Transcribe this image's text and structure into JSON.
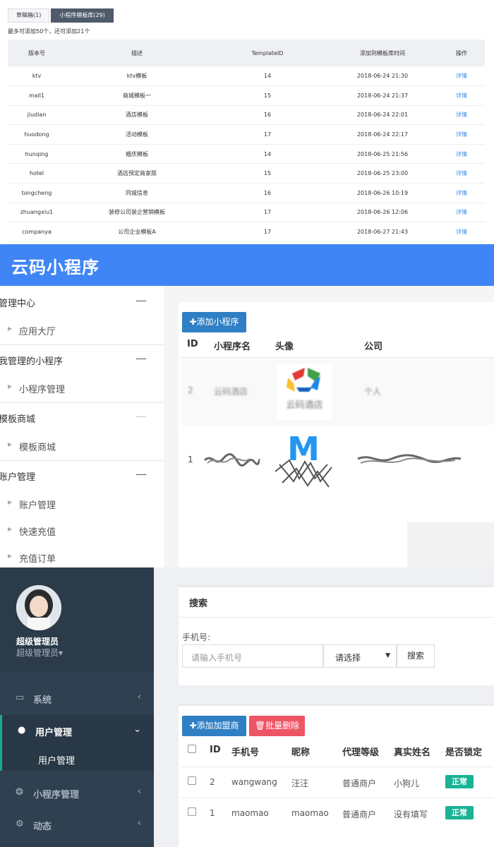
{
  "panel1": {
    "tabs": [
      "草稿箱(1)",
      "小程序模板库(29)"
    ],
    "hint": "最多可添加50个，还可添加21个",
    "columns": [
      "版本号",
      "描述",
      "TemplateID",
      "添加到模板库时间",
      "操作"
    ],
    "rows": [
      [
        "ktv",
        "ktv模板",
        "14",
        "2018-06-24 21:30",
        "详情"
      ],
      [
        "mall1",
        "商城模板一",
        "15",
        "2018-06-24 21:37",
        "详情"
      ],
      [
        "jiudian",
        "酒店模板",
        "16",
        "2018-06-24 22:01",
        "详情"
      ],
      [
        "huodong",
        "活动模板",
        "17",
        "2018-06-24 22:17",
        "详情"
      ],
      [
        "hunqing",
        "婚庆模板",
        "14",
        "2018-06-25 21:56",
        "详情"
      ],
      [
        "hotel",
        "酒店预定商家版",
        "15",
        "2018-06-25 23:00",
        "详情"
      ],
      [
        "tongcheng",
        "同城信息",
        "16",
        "2018-06-26 10:19",
        "详情"
      ],
      [
        "zhuangxiu1",
        "装修公司装企营销模板",
        "17",
        "2018-06-26 12:06",
        "详情"
      ],
      [
        "companya",
        "公司企业模板A",
        "17",
        "2018-06-27 21:43",
        "详情"
      ]
    ]
  },
  "panel2": {
    "brand": "云码小程序",
    "nav": [
      {
        "group": "管理中心",
        "toggle": "—",
        "items": [
          "应用大厅"
        ]
      },
      {
        "group": "我管理的小程序",
        "toggle": "—",
        "items": [
          "小程序管理"
        ]
      },
      {
        "group": "模板商城",
        "toggle": "—",
        "items": [
          "模板商城"
        ]
      },
      {
        "group": "账户管理",
        "toggle": "—",
        "items": [
          "账户管理",
          "快速充值",
          "充值订单"
        ]
      }
    ],
    "add_button": "✚添加小程序",
    "columns": [
      "ID",
      "小程序名",
      "头像",
      "公司"
    ],
    "rows": [
      {
        "id": "2",
        "name": "云码酒店",
        "company": "个人",
        "logo_text": "云码酒店"
      },
      {
        "id": "1",
        "name": "",
        "company": "",
        "logo_text": "M"
      }
    ],
    "colors": {
      "header": "#3f85f5",
      "button": "#2f7fc4"
    }
  },
  "panel3": {
    "user": {
      "name": "超级管理员",
      "role": "超级管理员",
      "caret": "▾"
    },
    "nav": [
      {
        "label": "系统",
        "icon": "monitor-icon",
        "glyph": "▭",
        "chevron": "‹"
      },
      {
        "label": "用户管理",
        "icon": "user-icon",
        "glyph": "●",
        "chevron": "⌄",
        "active": true
      },
      {
        "label": "小程序管理",
        "icon": "wechat-icon",
        "glyph": "❂",
        "chevron": "‹"
      },
      {
        "label": "动态",
        "icon": "gears-icon",
        "glyph": "⚙",
        "chevron": "‹"
      }
    ],
    "sub_item": "用户管理",
    "search": {
      "title": "搜索",
      "label": "手机号:",
      "placeholder": "请输入手机号",
      "select_value": "请选择",
      "button": "搜索"
    },
    "buttons": {
      "add": "✚添加加盟商",
      "delete": "🗑批量删除"
    },
    "columns": [
      "ID",
      "手机号",
      "昵称",
      "代理等级",
      "真实姓名",
      "是否锁定"
    ],
    "rows": [
      {
        "id": "2",
        "phone": "wangwang",
        "nick": "汪汪",
        "level": "普通商户",
        "real": "小狗儿",
        "status": "正常"
      },
      {
        "id": "1",
        "phone": "maomao",
        "nick": "maomao",
        "level": "普通商户",
        "real": "没有填写",
        "status": "正常"
      }
    ],
    "colors": {
      "sidebar": "#2f4050",
      "accent": "#19aa8d",
      "badge": "#1ab394",
      "add": "#2f7fc4",
      "delete": "#ed5565"
    }
  }
}
